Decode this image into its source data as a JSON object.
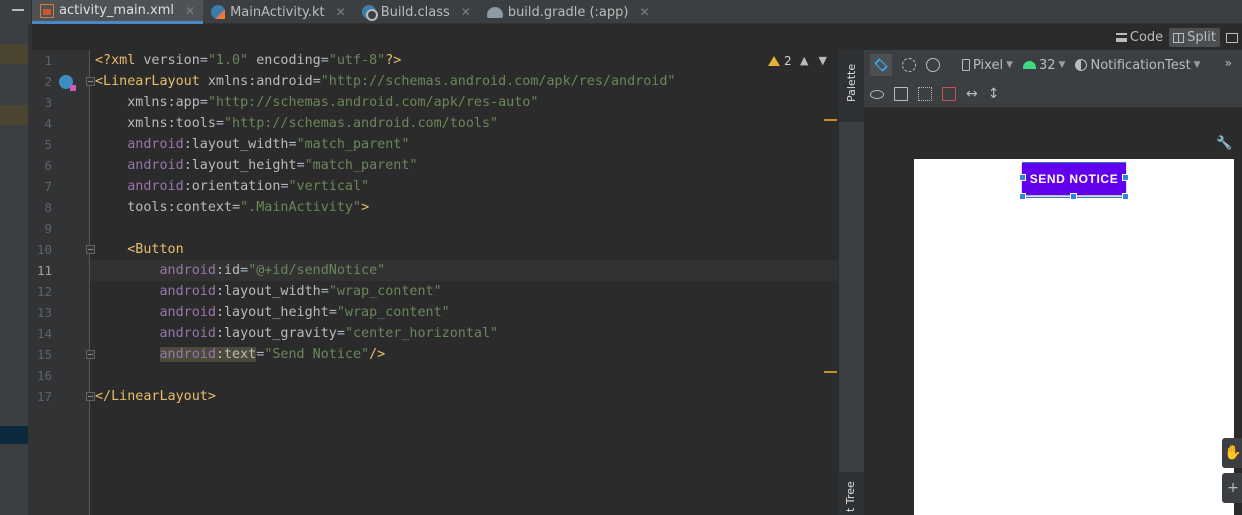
{
  "tabs": [
    {
      "label": "activity_main.xml",
      "icon": "xml-file-icon",
      "active": true
    },
    {
      "label": "MainActivity.kt",
      "icon": "kotlin-file-icon",
      "active": false
    },
    {
      "label": "Build.class",
      "icon": "class-file-icon",
      "active": false
    },
    {
      "label": "build.gradle (:app)",
      "icon": "gradle-file-icon",
      "active": false
    }
  ],
  "view_modes": {
    "code": "Code",
    "split": "Split",
    "active": "Split"
  },
  "editor": {
    "warnings_count": "2",
    "current_line": 11,
    "line_numbers": [
      "1",
      "2",
      "3",
      "4",
      "5",
      "6",
      "7",
      "8",
      "9",
      "10",
      "11",
      "12",
      "13",
      "14",
      "15",
      "16",
      "17"
    ],
    "lines": [
      "<?xml version=\"1.0\" encoding=\"utf-8\"?>",
      "<LinearLayout xmlns:android=\"http://schemas.android.com/apk/res/android\"",
      "    xmlns:app=\"http://schemas.android.com/apk/res-auto\"",
      "    xmlns:tools=\"http://schemas.android.com/tools\"",
      "    android:layout_width=\"match_parent\"",
      "    android:layout_height=\"match_parent\"",
      "    android:orientation=\"vertical\"",
      "    tools:context=\".MainActivity\">",
      "",
      "    <Button",
      "        android:id=\"@+id/sendNotice\"",
      "        android:layout_width=\"wrap_content\"",
      "        android:layout_height=\"wrap_content\"",
      "        android:layout_gravity=\"center_horizontal\"",
      "        android:text=\"Send Notice\"/>",
      "",
      "</LinearLayout>"
    ]
  },
  "side_panels": {
    "palette": "Palette",
    "component_tree": "t Tree"
  },
  "design_toolbar": {
    "device": "Pixel",
    "api_level": "32",
    "theme": "NotificationTest"
  },
  "preview": {
    "button_text": "SEND NOTICE",
    "button_color": "#6200ee"
  }
}
